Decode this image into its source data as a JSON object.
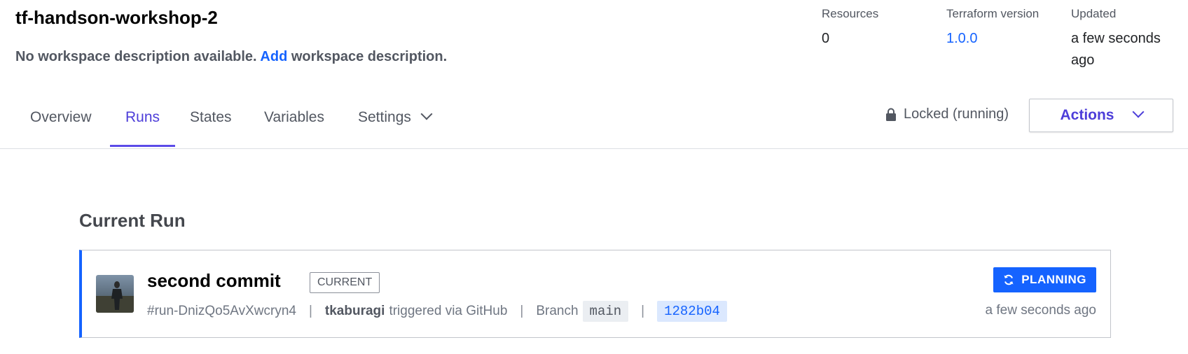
{
  "workspace": {
    "title": "tf-handson-workshop-2",
    "description_prefix": "No workspace description available.",
    "description_link": "Add",
    "description_suffix": "workspace description."
  },
  "meta": {
    "resources_label": "Resources",
    "resources_value": "0",
    "tf_version_label": "Terraform version",
    "tf_version_value": "1.0.0",
    "updated_label": "Updated",
    "updated_value": "a few seconds ago"
  },
  "nav": {
    "tabs": [
      {
        "label": "Overview"
      },
      {
        "label": "Runs"
      },
      {
        "label": "States"
      },
      {
        "label": "Variables"
      },
      {
        "label": "Settings"
      }
    ],
    "active_tab": "Runs",
    "lock_status": "Locked (running)",
    "actions_label": "Actions"
  },
  "current_run": {
    "section_title": "Current Run",
    "title": "second commit",
    "badge": "CURRENT",
    "run_id": "#run-DnizQo5AvXwcryn4",
    "user": "tkaburagi",
    "trigger_text": "triggered via GitHub",
    "branch_label": "Branch",
    "branch": "main",
    "commit": "1282b04",
    "status": "PLANNING",
    "time": "a few seconds ago"
  },
  "colors": {
    "accent": "#5b4be8",
    "link": "#1563ff",
    "status_planning": "#1563ff"
  },
  "icons": {
    "lock": "lock-icon",
    "chevron": "chevron-down-icon",
    "status": "refresh-icon"
  }
}
